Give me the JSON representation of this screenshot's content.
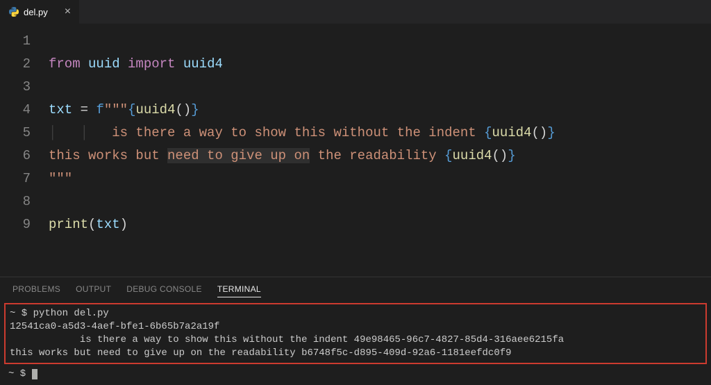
{
  "tab": {
    "filename": "del.py",
    "icon": "python-file-icon"
  },
  "editor": {
    "line_numbers": [
      "1",
      "2",
      "3",
      "4",
      "5",
      "6",
      "7",
      "8",
      "9"
    ],
    "code": {
      "l1_from": "from",
      "l1_mod": "uuid",
      "l1_import": "import",
      "l1_name": "uuid4",
      "l3_var": "txt",
      "l3_eq": "=",
      "l3_fprefix": "f",
      "l3_open": "\"\"\"",
      "l3_callname": "uuid4",
      "l4_text": "is there a way to show this without the indent ",
      "l4_callname": "uuid4",
      "l5_text_a": "this works but ",
      "l5_text_hl": "need to give up on",
      "l5_text_b": " the readability ",
      "l5_callname": "uuid4",
      "l6_close": "\"\"\"",
      "l8_print": "print",
      "l8_arg": "txt"
    }
  },
  "panel": {
    "tabs": {
      "problems": "PROBLEMS",
      "output": "OUTPUT",
      "debug": "DEBUG CONSOLE",
      "terminal": "TERMINAL"
    },
    "active": "terminal"
  },
  "terminal": {
    "cmd": "~ $ python del.py",
    "out1": "12541ca0-a5d3-4aef-bfe1-6b65b7a2a19f",
    "out2": "            is there a way to show this without the indent 49e98465-96c7-4827-85d4-316aee6215fa",
    "out3": "this works but need to give up on the readability b6748f5c-d895-409d-92a6-1181eefdc0f9",
    "prompt": "~ $ "
  }
}
